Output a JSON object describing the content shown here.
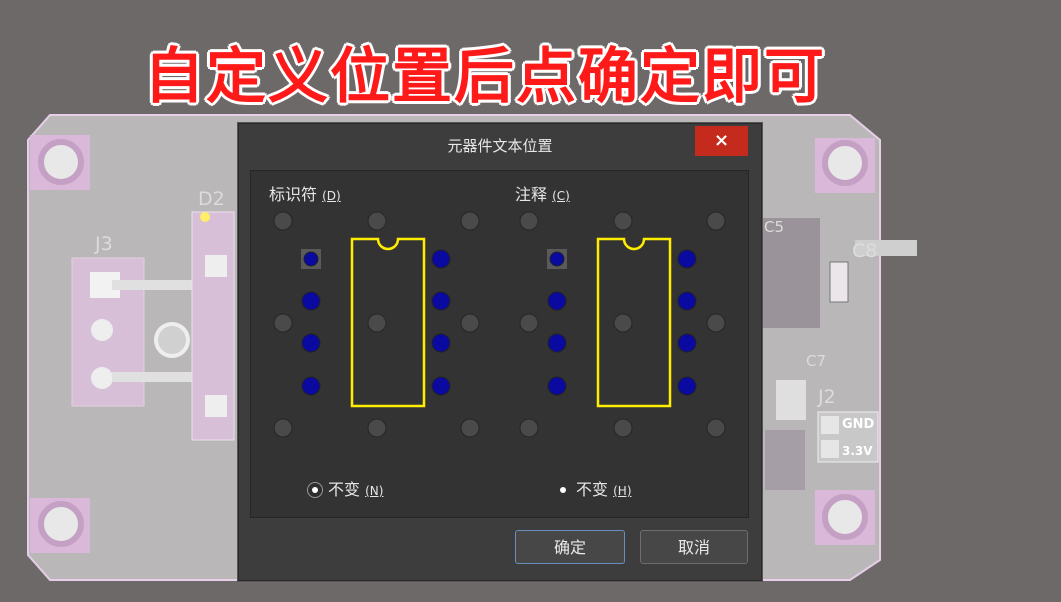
{
  "banner": {
    "text": "自定义位置后点确定即可"
  },
  "pcb": {
    "labels": {
      "j3": "J3",
      "d2": "D2",
      "j2": "J2",
      "c8": "C8",
      "c5": "C5",
      "c7": "C7",
      "gnd": "GND",
      "v33": "3.3V"
    }
  },
  "dialog": {
    "title": "元器件文本位置",
    "close_label": "×",
    "designator": {
      "label": "标识符",
      "hotkey": "(D)",
      "option_label": "不变",
      "option_hotkey": "(N)",
      "option_selected": true
    },
    "comment": {
      "label": "注释",
      "hotkey": "(C)",
      "option_label": "不变",
      "option_hotkey": "(H)",
      "option_selected": true
    },
    "ok_label": "确定",
    "cancel_label": "取消"
  },
  "colors": {
    "chip_outline": "#ffee00",
    "pin": "#0a0aa0",
    "position_dot": "#4a4a4a",
    "close_bg": "#c42b1c",
    "banner_text": "#ff1a1a"
  }
}
